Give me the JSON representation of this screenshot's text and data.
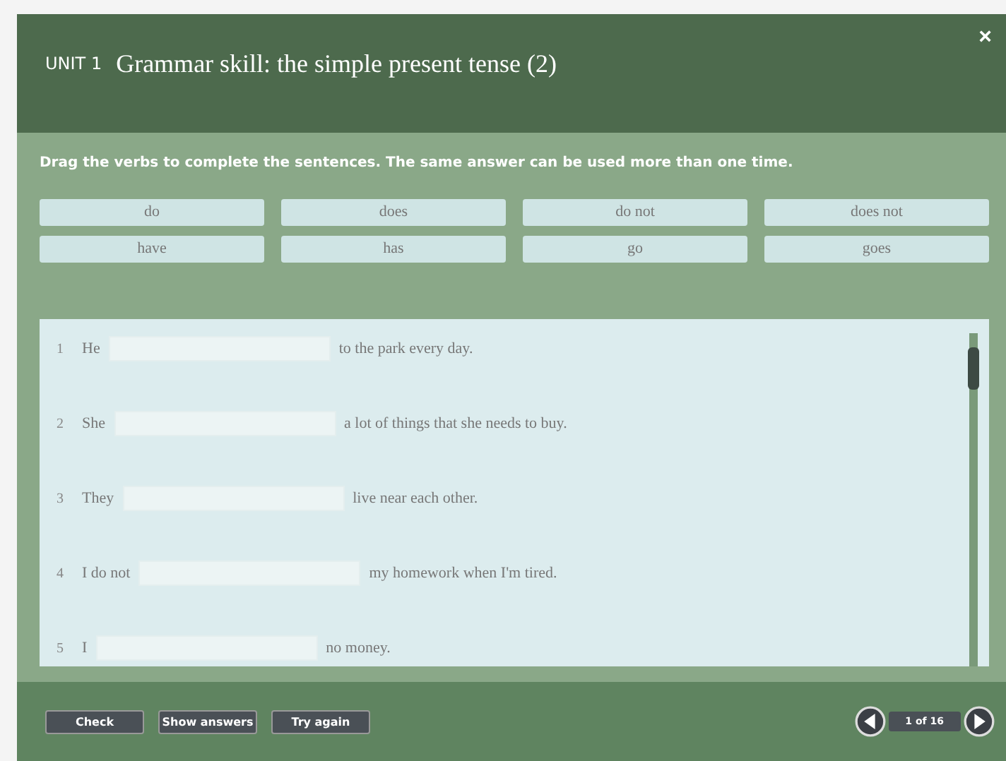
{
  "header": {
    "unit": "UNIT 1",
    "title": "Grammar skill: the simple present tense (2)",
    "close": "×"
  },
  "instruction": "Drag the verbs to complete the sentences. The same answer can be used more than one time.",
  "verbs": [
    "do",
    "does",
    "do not",
    "does not",
    "have",
    "has",
    "go",
    "goes"
  ],
  "sentences": [
    {
      "number": "1",
      "before": "He",
      "after": "to the park every day."
    },
    {
      "number": "2",
      "before": "She",
      "after": "a lot of things that she needs to buy."
    },
    {
      "number": "3",
      "before": "They",
      "after": "live near each other."
    },
    {
      "number": "4",
      "before": "I do not",
      "after": "my homework when I'm tired."
    },
    {
      "number": "5",
      "before": "I",
      "after": "no money."
    }
  ],
  "buttons": [
    "Check",
    "Show answers",
    "Try again"
  ],
  "pager": "1 of 16"
}
